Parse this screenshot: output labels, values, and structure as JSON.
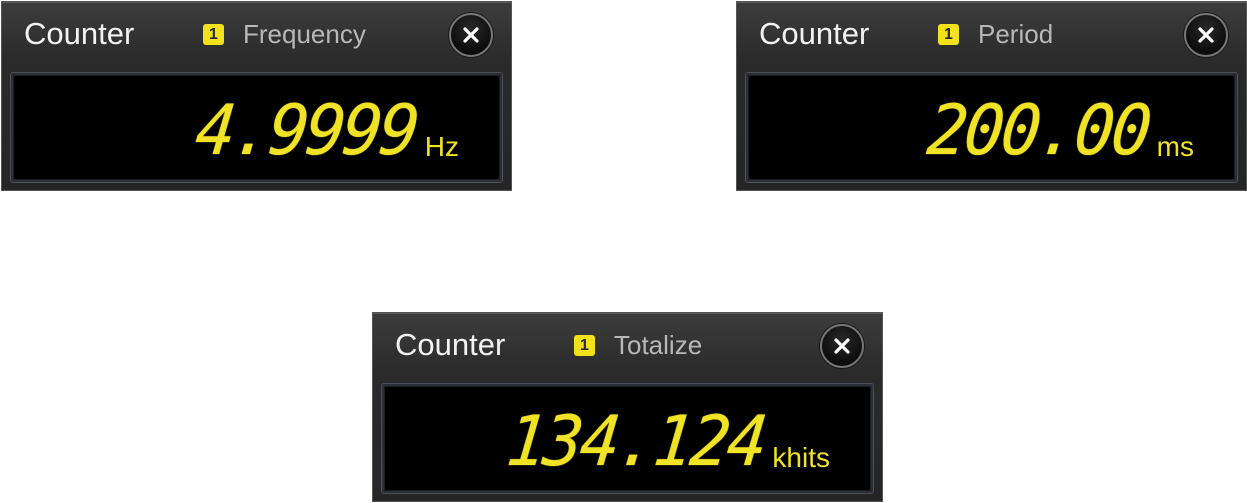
{
  "panels": [
    {
      "title": "Counter",
      "channel": "1",
      "mode": "Frequency",
      "value": "4.9999",
      "unit": "Hz",
      "close_icon": "close-icon"
    },
    {
      "title": "Counter",
      "channel": "1",
      "mode": "Period",
      "value": "200.00",
      "unit": "ms",
      "close_icon": "close-icon"
    },
    {
      "title": "Counter",
      "channel": "1",
      "mode": "Totalize",
      "value": "134.124",
      "unit": "khits",
      "close_icon": "close-icon"
    }
  ],
  "colors": {
    "readout": "#f0e224",
    "channel_badge": "#f3e21a",
    "panel_background": "#2b2b2b",
    "display_background": "#000000"
  }
}
